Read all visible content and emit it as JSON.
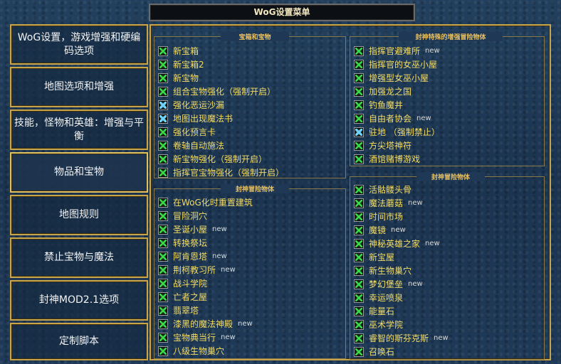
{
  "window": {
    "title": "WoG设置菜单"
  },
  "sidebar": {
    "items": [
      {
        "label": "WoG设置，游戏增强和硬编码选项"
      },
      {
        "label": "地图选项和增强"
      },
      {
        "label": "技能，怪物和英雄：增强与平衡"
      },
      {
        "label": "物品和宝物",
        "selected": true
      },
      {
        "label": "地图规则"
      },
      {
        "label": "禁止宝物与魔法"
      },
      {
        "label": "封神MOD2.1选项"
      },
      {
        "label": "定制脚本"
      }
    ]
  },
  "groups": {
    "treasure": {
      "title": "宝箱和宝物",
      "items": [
        {
          "label": "新宝箱",
          "check": "green",
          "new": ""
        },
        {
          "label": "新宝箱2",
          "check": "green",
          "new": ""
        },
        {
          "label": "新宝物",
          "check": "green",
          "new": ""
        },
        {
          "label": "组合宝物强化（强制开启）",
          "check": "green",
          "new": ""
        },
        {
          "label": "强化恶运沙漏",
          "check": "blue",
          "new": ""
        },
        {
          "label": "地图出现魔法书",
          "check": "blue",
          "new": ""
        },
        {
          "label": "强化预言卡",
          "check": "green",
          "new": ""
        },
        {
          "label": "卷轴自动施法",
          "check": "green",
          "new": ""
        },
        {
          "label": "新宝物强化（强制开启）",
          "check": "green",
          "new": ""
        },
        {
          "label": "指挥官宝物强化（强制开启）",
          "check": "green",
          "new": ""
        }
      ]
    },
    "special": {
      "title": "封神特殊的增强冒险物体",
      "items": [
        {
          "label": "指挥官避难所",
          "check": "green",
          "new": "new"
        },
        {
          "label": "指挥官的女巫小屋",
          "check": "green",
          "new": ""
        },
        {
          "label": "增强型女巫小屋",
          "check": "green",
          "new": ""
        },
        {
          "label": "加强龙之国",
          "check": "green",
          "new": ""
        },
        {
          "label": "钓鱼魔井",
          "check": "green",
          "new": ""
        },
        {
          "label": "自由者协会",
          "check": "green",
          "new": "new"
        },
        {
          "label": "驻地 （强制禁止）",
          "check": "blue",
          "new": ""
        },
        {
          "label": "方尖塔神符",
          "check": "green",
          "new": ""
        },
        {
          "label": "酒馆赌博游戏",
          "check": "green",
          "new": ""
        }
      ]
    },
    "adventure_left": {
      "title": "封神冒险物体",
      "items": [
        {
          "label": "在WoG化时重置建筑",
          "check": "green",
          "new": ""
        },
        {
          "label": "冒险洞穴",
          "check": "green",
          "new": ""
        },
        {
          "label": "圣诞小屋",
          "check": "green",
          "new": "new"
        },
        {
          "label": "转换祭坛",
          "check": "green",
          "new": ""
        },
        {
          "label": "阿肯恩塔",
          "check": "green",
          "new": "new"
        },
        {
          "label": "荆柯教习所",
          "check": "green",
          "new": "new"
        },
        {
          "label": "战斗学院",
          "check": "green",
          "new": ""
        },
        {
          "label": "亡者之屋",
          "check": "green",
          "new": ""
        },
        {
          "label": "翡翠塔",
          "check": "green",
          "new": ""
        },
        {
          "label": "漆黑的魔法神殿",
          "check": "green",
          "new": "new"
        },
        {
          "label": "宝物典当行",
          "check": "green",
          "new": "new"
        },
        {
          "label": "八级生物巢穴",
          "check": "green",
          "new": ""
        }
      ]
    },
    "adventure_right": {
      "title": "封神冒险物体",
      "items": [
        {
          "label": "活骷髅头骨",
          "check": "green",
          "new": ""
        },
        {
          "label": "魔法蘑菇",
          "check": "green",
          "new": "new"
        },
        {
          "label": "时间市场",
          "check": "green",
          "new": ""
        },
        {
          "label": "魔镜",
          "check": "green",
          "new": "new"
        },
        {
          "label": "神秘英雄之家",
          "check": "green",
          "new": "new"
        },
        {
          "label": "新宝屋",
          "check": "green",
          "new": ""
        },
        {
          "label": "新生物巢穴",
          "check": "green",
          "new": ""
        },
        {
          "label": "梦幻堡垒",
          "check": "green",
          "new": "new"
        },
        {
          "label": "幸运喷泉",
          "check": "green",
          "new": ""
        },
        {
          "label": "能量石",
          "check": "green",
          "new": ""
        },
        {
          "label": "巫术学院",
          "check": "green",
          "new": ""
        },
        {
          "label": "睿智的斯芬克斯",
          "check": "green",
          "new": "new"
        },
        {
          "label": "召唤石",
          "check": "green",
          "new": ""
        }
      ]
    }
  },
  "colors": {
    "accent": "#c8a44a",
    "label": "#f4dc64",
    "check_green": "#39d84a",
    "check_blue": "#6fd3ff"
  }
}
